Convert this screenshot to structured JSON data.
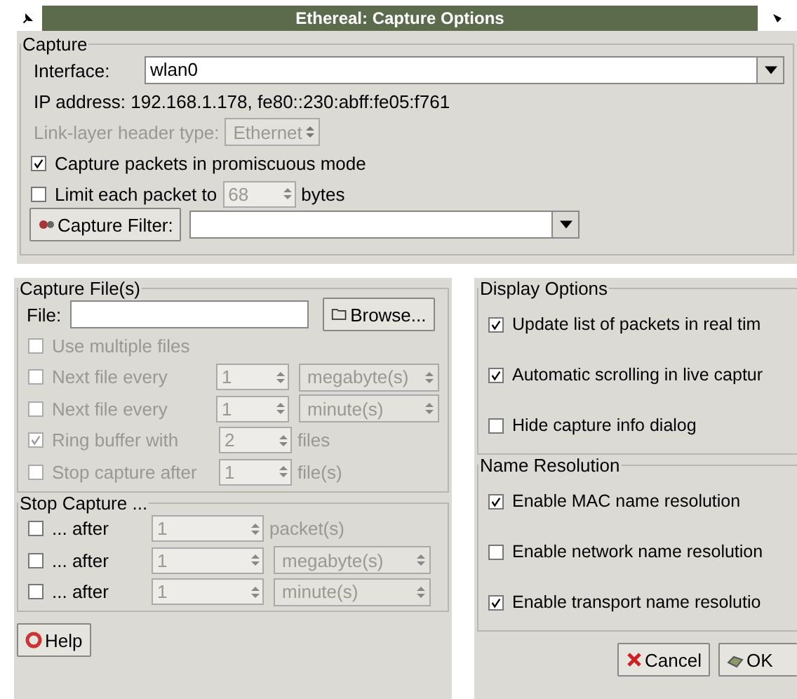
{
  "window": {
    "title": "Ethereal: Capture Options"
  },
  "capture": {
    "title": "Capture",
    "interface_label": "Interface:",
    "interface_value": "wlan0",
    "ip_address": "IP address: 192.168.1.178, fe80::230:abff:fe05:f761",
    "link_layer_label": "Link-layer header type:",
    "link_layer_value": "Ethernet",
    "link_layer_disabled": true,
    "promiscuous": {
      "label": "Capture packets in promiscuous mode",
      "checked": true
    },
    "limit": {
      "label": "Limit each packet to",
      "checked": false,
      "value": "68",
      "unit": "bytes",
      "field_disabled": true
    },
    "filter_button": "Capture Filter:"
  },
  "capture_files": {
    "title": "Capture File(s)",
    "file_label": "File:",
    "browse_button": "Browse...",
    "rows": [
      {
        "kind": "check",
        "label": "Use multiple files",
        "checked": false,
        "disabled": true
      },
      {
        "kind": "spin_combo",
        "label": "Next file every",
        "checked": false,
        "disabled": true,
        "value": "1",
        "unit": "megabyte(s)",
        "field_disabled": true
      },
      {
        "kind": "spin_combo",
        "label": "Next file every",
        "checked": false,
        "disabled": true,
        "value": "1",
        "unit": "minute(s)",
        "field_disabled": true
      },
      {
        "kind": "spin_unit",
        "label": "Ring buffer with",
        "checked": true,
        "disabled": true,
        "value": "2",
        "unit": "files",
        "field_disabled": true
      },
      {
        "kind": "spin_unit",
        "label": "Stop capture after",
        "checked": false,
        "disabled": true,
        "value": "1",
        "unit": "file(s)",
        "field_disabled": true
      }
    ]
  },
  "stop_capture": {
    "title": "Stop Capture ...",
    "rows": [
      {
        "kind": "spin_unit",
        "label": "... after",
        "checked": false,
        "disabled": false,
        "value": "1",
        "unit": "packet(s)",
        "field_disabled": true
      },
      {
        "kind": "spin_combo",
        "label": "... after",
        "checked": false,
        "disabled": false,
        "value": "1",
        "unit": "megabyte(s)",
        "field_disabled": true
      },
      {
        "kind": "spin_combo",
        "label": "... after",
        "checked": false,
        "disabled": false,
        "value": "1",
        "unit": "minute(s)",
        "field_disabled": true
      }
    ]
  },
  "display_options": {
    "title": "Display Options",
    "items": [
      {
        "label": "Update list of packets in real tim",
        "checked": true
      },
      {
        "label": "Automatic scrolling in live captur",
        "checked": true
      },
      {
        "label": "Hide capture info dialog",
        "checked": false
      }
    ]
  },
  "name_resolution": {
    "title": "Name Resolution",
    "items": [
      {
        "label": "Enable MAC name resolution",
        "checked": true
      },
      {
        "label": "Enable network name resolution",
        "checked": false
      },
      {
        "label": "Enable transport name resolutio",
        "checked": true
      }
    ]
  },
  "buttons": {
    "help": "Help",
    "cancel": "Cancel",
    "ok": "OK"
  }
}
